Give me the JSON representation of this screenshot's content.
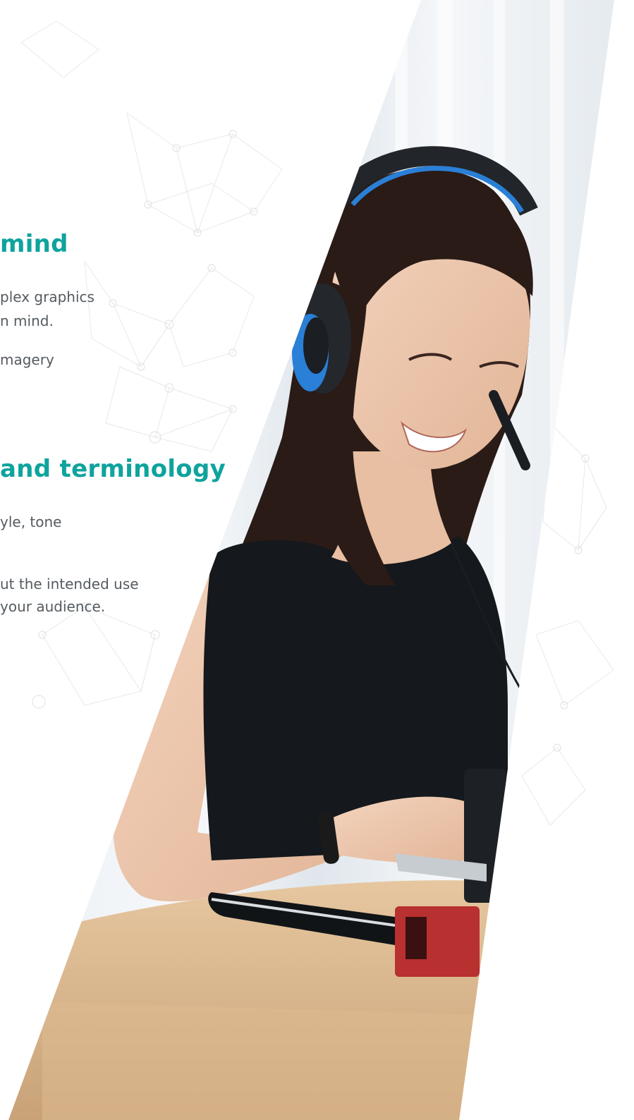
{
  "theme": {
    "accent": "#0fa39d",
    "body_text": "#555b60"
  },
  "sections": [
    {
      "heading": "mind",
      "lines": [
        "plex graphics",
        "n mind.",
        "magery"
      ]
    },
    {
      "heading": "and terminology",
      "lines": [
        "yle, tone",
        "ut the intended use",
        " your audience."
      ]
    }
  ],
  "photo": {
    "description_icon": "woman-with-headset-photo"
  }
}
